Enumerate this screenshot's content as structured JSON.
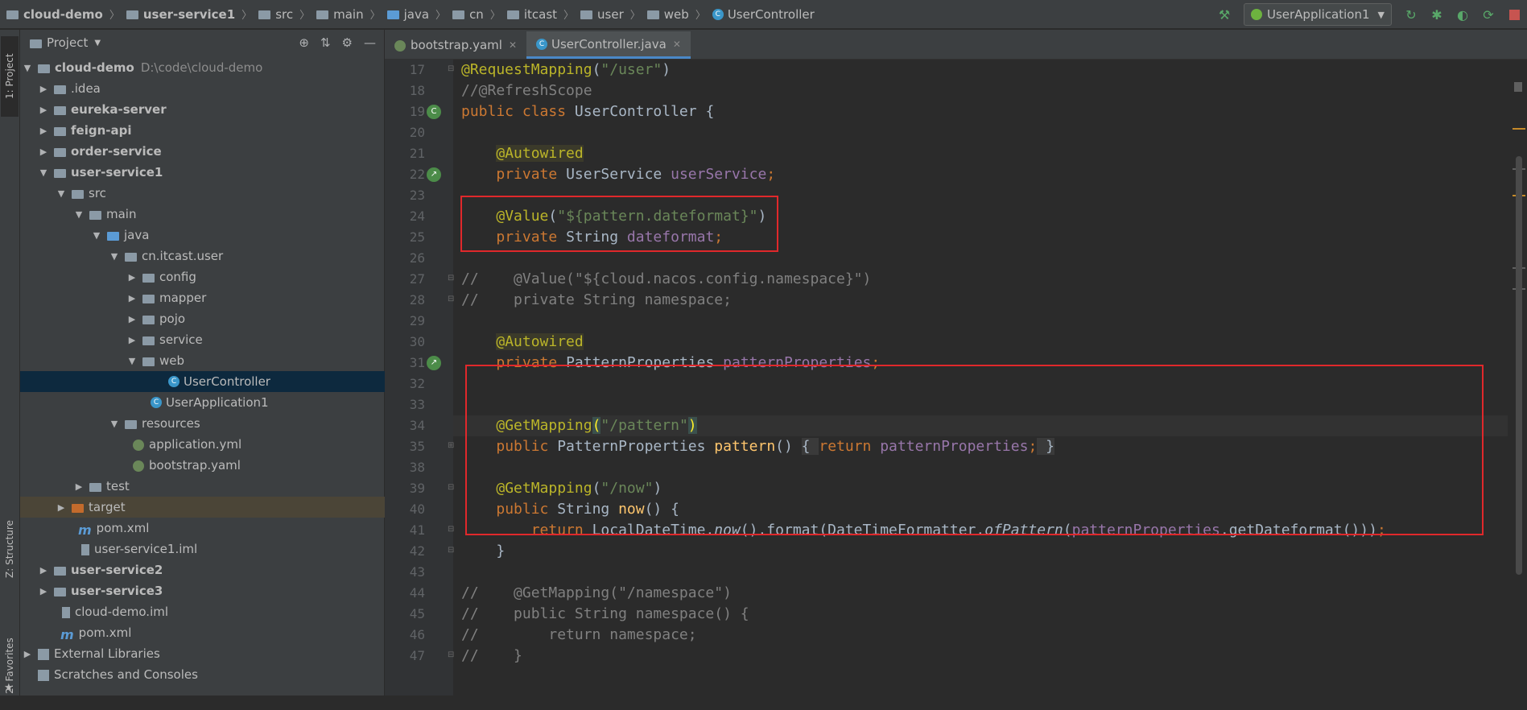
{
  "breadcrumbs": [
    "cloud-demo",
    "user-service1",
    "src",
    "main",
    "java",
    "cn",
    "itcast",
    "user",
    "web",
    "UserController"
  ],
  "run_config": "UserApplication1",
  "left_strip": {
    "project_tab": "1: Project",
    "structure_tab": "Z: Structure",
    "favorites_tab": "2: Favorites"
  },
  "project_panel": {
    "title": "Project",
    "tree": [
      {
        "label": "cloud-demo",
        "hint": "D:\\code\\cloud-demo"
      },
      {
        "label": ".idea"
      },
      {
        "label": "eureka-server"
      },
      {
        "label": "feign-api"
      },
      {
        "label": "order-service"
      },
      {
        "label": "user-service1"
      },
      {
        "label": "src"
      },
      {
        "label": "main"
      },
      {
        "label": "java"
      },
      {
        "label": "cn.itcast.user"
      },
      {
        "label": "config"
      },
      {
        "label": "mapper"
      },
      {
        "label": "pojo"
      },
      {
        "label": "service"
      },
      {
        "label": "web"
      },
      {
        "label": "UserController"
      },
      {
        "label": "UserApplication1"
      },
      {
        "label": "resources"
      },
      {
        "label": "application.yml"
      },
      {
        "label": "bootstrap.yaml"
      },
      {
        "label": "test"
      },
      {
        "label": "target"
      },
      {
        "label": "pom.xml"
      },
      {
        "label": "user-service1.iml"
      },
      {
        "label": "user-service2"
      },
      {
        "label": "user-service3"
      },
      {
        "label": "cloud-demo.iml"
      },
      {
        "label": "pom.xml"
      },
      {
        "label": "External Libraries"
      },
      {
        "label": "Scratches and Consoles"
      }
    ]
  },
  "editor": {
    "tabs": [
      {
        "label": "bootstrap.yaml",
        "active": false
      },
      {
        "label": "UserController.java",
        "active": true
      }
    ],
    "line_numbers": [
      "17",
      "18",
      "19",
      "20",
      "21",
      "22",
      "23",
      "24",
      "25",
      "26",
      "27",
      "28",
      "29",
      "30",
      "31",
      "32",
      "33",
      "34",
      "35",
      "38",
      "39",
      "40",
      "41",
      "42",
      "43",
      "44",
      "45",
      "46",
      "47"
    ]
  }
}
